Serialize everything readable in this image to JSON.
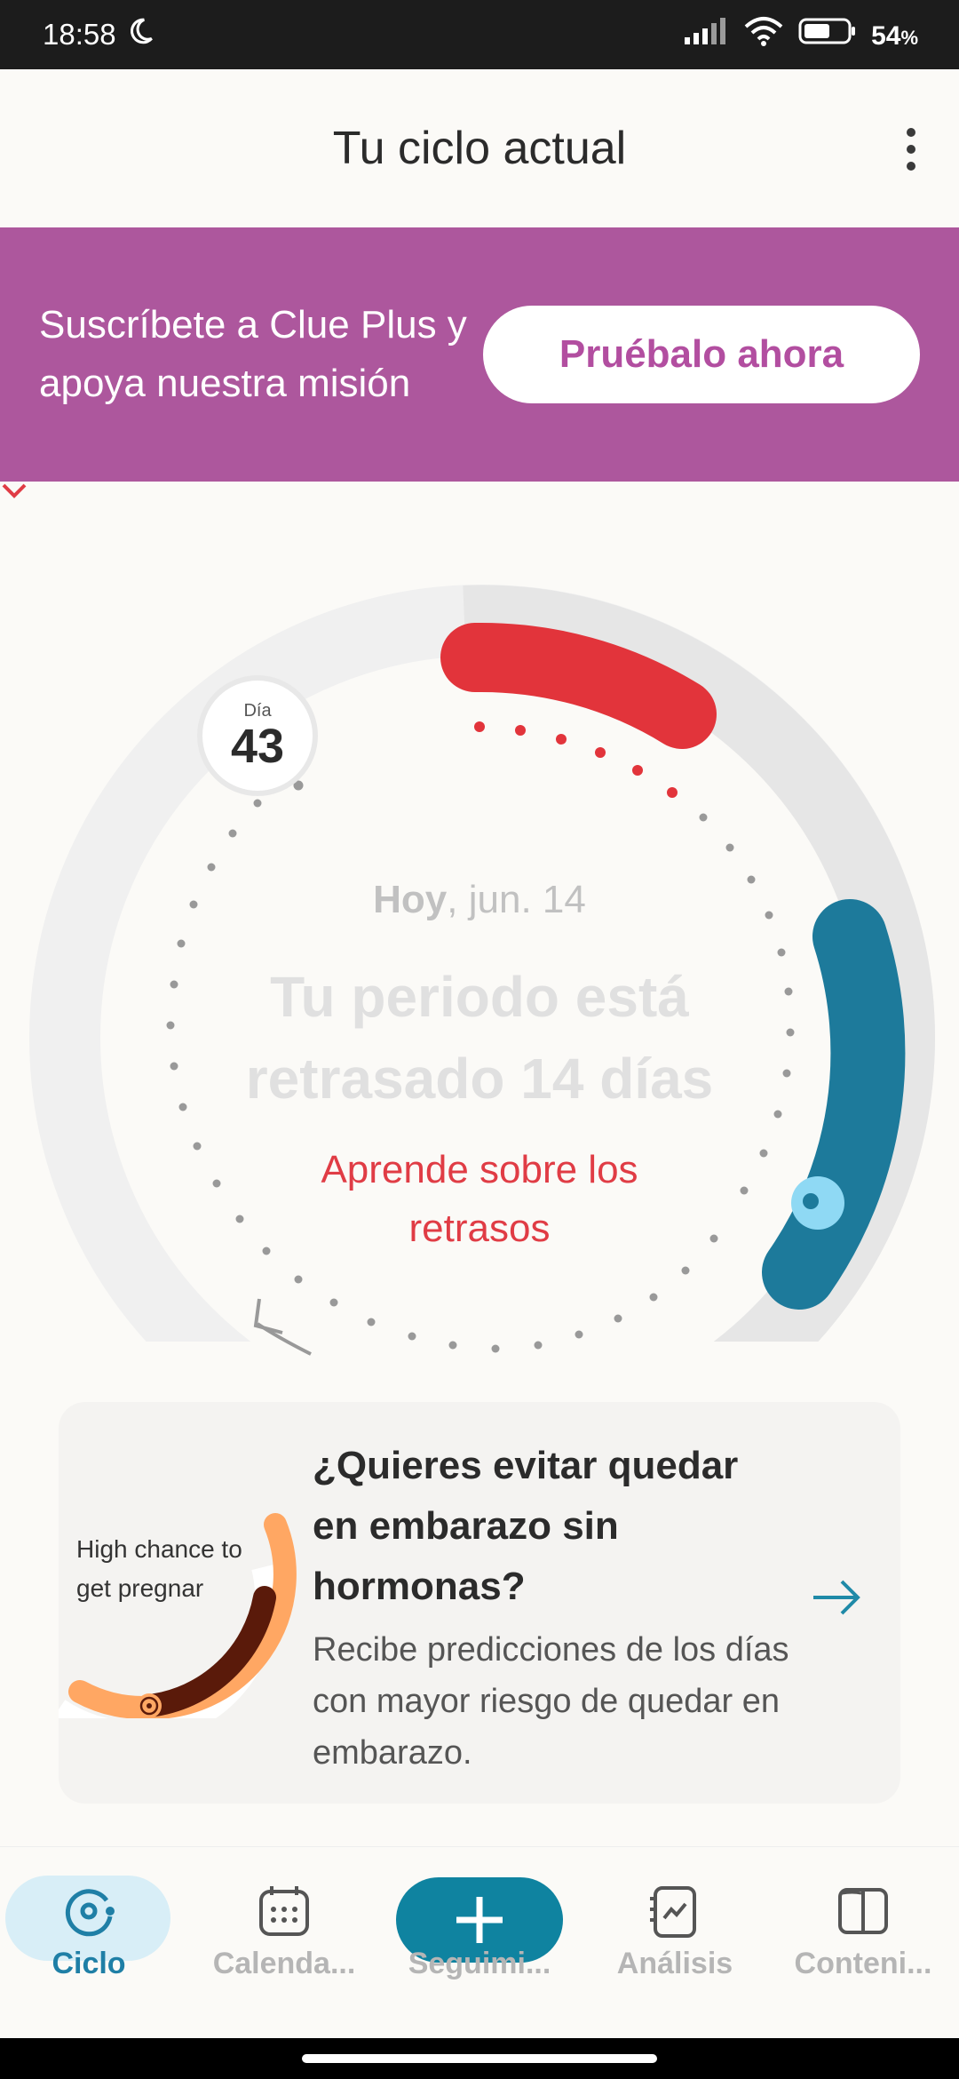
{
  "status_bar": {
    "time": "18:58",
    "battery": "54",
    "battery_unit": "%"
  },
  "header": {
    "title": "Tu ciclo actual"
  },
  "promo": {
    "text": "Suscríbete a Clue Plus y apoya nuestra misión",
    "button": "Pruébalo ahora"
  },
  "cycle": {
    "day_label": "Día",
    "day_number": "43",
    "today_bold": "Hoy",
    "today_date": ", jun. 14",
    "status": "Tu periodo está retrasado 14 días",
    "learn_link": "Aprende sobre los retrasos"
  },
  "card": {
    "chance_label": "High chance to get pregnar",
    "title": "¿Quieres evitar quedar en embarazo sin hormonas?",
    "description": "Recibe predicciones de los días con mayor riesgo de quedar en embarazo."
  },
  "nav": {
    "items": [
      {
        "label": "Ciclo"
      },
      {
        "label": "Calenda..."
      },
      {
        "label": "Seguimi..."
      },
      {
        "label": "Análisis"
      },
      {
        "label": "Conteni..."
      }
    ]
  },
  "colors": {
    "promo_bg": "#AD579D",
    "period_red": "#E2343B",
    "fertile_blue": "#1D7A9B",
    "accent_teal": "#0F83A0",
    "link_red": "#E03C45"
  }
}
